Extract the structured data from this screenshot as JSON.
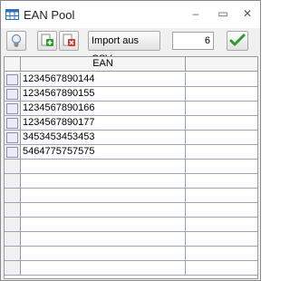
{
  "window": {
    "title": "EAN Pool"
  },
  "titlebar": {
    "minimize": "–",
    "maximize": "▭",
    "close": "✕"
  },
  "toolbar": {
    "import_label": "Import aus CSV",
    "count_value": "6"
  },
  "grid": {
    "column_header": "EAN",
    "rows": [
      "1234567890144",
      "1234567890155",
      "1234567890166",
      "1234567890177",
      "3453453453453",
      "5464775757575",
      "",
      "",
      "",
      "",
      "",
      "",
      "",
      ""
    ]
  },
  "colors": {
    "grid_line": "#9aa3c0",
    "confirm_green": "#2e9a2e",
    "delete_red": "#d23a2a"
  }
}
